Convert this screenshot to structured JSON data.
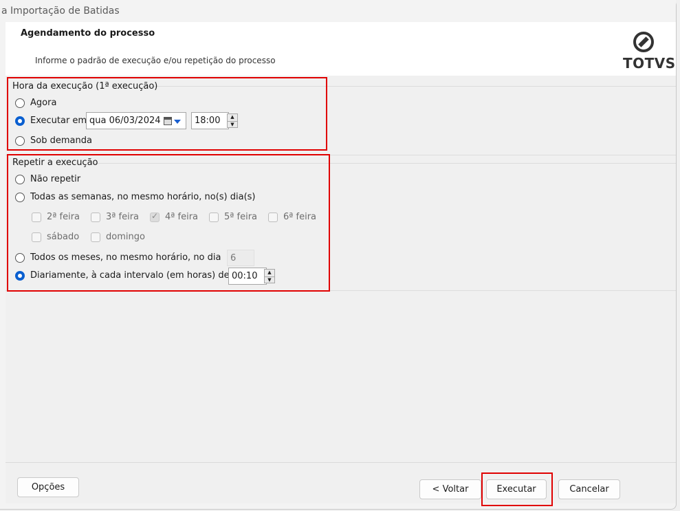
{
  "window": {
    "title": "Importação de Batidas",
    "title_prefix": "a"
  },
  "header": {
    "title": "Agendamento do processo",
    "subtitle": "Informe o padrão de execução e/ou repetição do processo",
    "logo_text": "TOTVS"
  },
  "exec_time": {
    "group_label": "Hora da execução (1ª execução)",
    "options": [
      {
        "label": "Agora",
        "checked": false
      },
      {
        "label": "Executar em",
        "checked": true
      },
      {
        "label": "Sob demanda",
        "checked": false
      }
    ],
    "date_value": "qua 06/03/2024",
    "time_value": "18:00"
  },
  "repeat": {
    "group_label": "Repetir a execução",
    "options": [
      {
        "label": "Não repetir",
        "checked": false
      },
      {
        "label": "Todas as semanas, no mesmo horário, no(s) dia(s)",
        "checked": false
      },
      {
        "label": "Todos os meses, no mesmo horário, no dia",
        "checked": false
      },
      {
        "label": "Diariamente, à cada intervalo (em horas) de",
        "checked": true
      }
    ],
    "weekdays": [
      {
        "label": "2ª feira",
        "checked": false
      },
      {
        "label": "3ª feira",
        "checked": false
      },
      {
        "label": "4ª feira",
        "checked": true
      },
      {
        "label": "5ª feira",
        "checked": false
      },
      {
        "label": "6ª feira",
        "checked": false
      },
      {
        "label": "sábado",
        "checked": false
      },
      {
        "label": "domingo",
        "checked": false
      }
    ],
    "month_day_value": "6",
    "interval_value": "00:10"
  },
  "footer": {
    "options_label": "Opções",
    "back_label": "< Voltar",
    "execute_label": "Executar",
    "cancel_label": "Cancelar"
  },
  "colors": {
    "accent": "#0a5fd0",
    "highlight": "#e00000"
  }
}
